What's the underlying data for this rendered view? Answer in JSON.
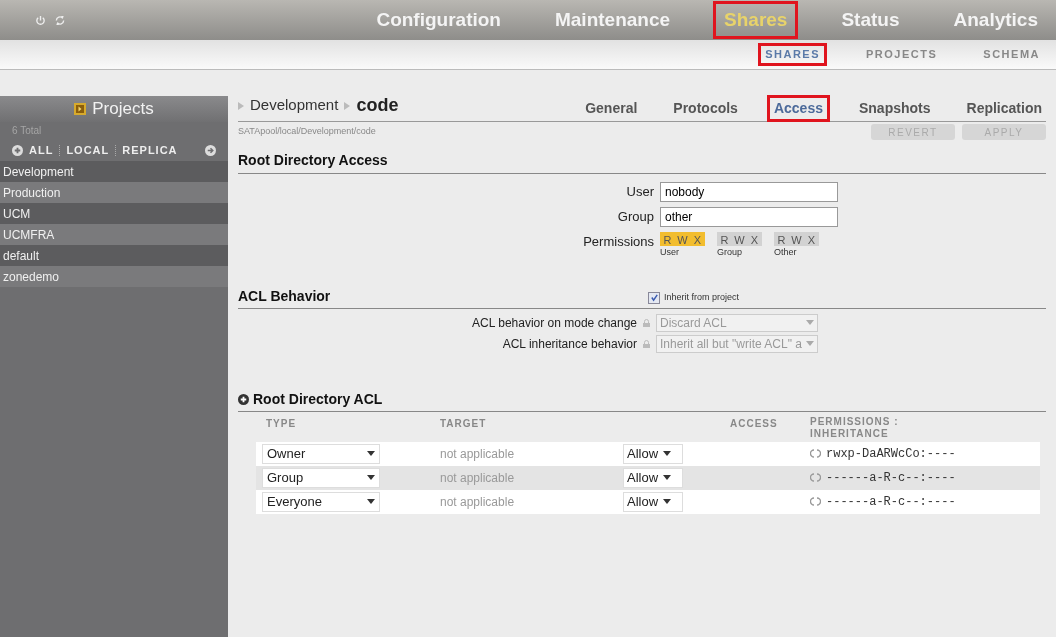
{
  "header": {
    "nav": [
      {
        "label": "Configuration",
        "selected": false,
        "highlighted": false
      },
      {
        "label": "Maintenance",
        "selected": false,
        "highlighted": false
      },
      {
        "label": "Shares",
        "selected": true,
        "highlighted": true
      },
      {
        "label": "Status",
        "selected": false,
        "highlighted": false
      },
      {
        "label": "Analytics",
        "selected": false,
        "highlighted": false
      }
    ],
    "subnav": [
      {
        "label": "SHARES",
        "selected": true,
        "highlighted": true
      },
      {
        "label": "PROJECTS",
        "selected": false,
        "highlighted": false
      },
      {
        "label": "SCHEMA",
        "selected": false,
        "highlighted": false
      }
    ]
  },
  "sidebar": {
    "title": "Projects",
    "count": "6 Total",
    "filters": [
      "ALL",
      "LOCAL",
      "REPLICA"
    ],
    "items": [
      "Development",
      "Production",
      "UCM",
      "UCMFRA",
      "default",
      "zonedemo"
    ]
  },
  "breadcrumb": [
    "Development",
    "code"
  ],
  "path": "SATApool/local/Development/code",
  "tabs": [
    {
      "label": "General",
      "selected": false,
      "highlighted": false
    },
    {
      "label": "Protocols",
      "selected": false,
      "highlighted": false
    },
    {
      "label": "Access",
      "selected": true,
      "highlighted": true
    },
    {
      "label": "Snapshots",
      "selected": false,
      "highlighted": false
    },
    {
      "label": "Replication",
      "selected": false,
      "highlighted": false
    }
  ],
  "buttons": [
    {
      "label": "REVERT",
      "disabled": true
    },
    {
      "label": "APPLY",
      "disabled": true
    }
  ],
  "root_access": {
    "title": "Root Directory Access",
    "user_label": "User",
    "user": "nobody",
    "group_label": "Group",
    "group": "other",
    "permissions_label": "Permissions",
    "permissions": [
      {
        "name": "User",
        "bits": [
          {
            "letter": "R",
            "on": true
          },
          {
            "letter": "W",
            "on": true
          },
          {
            "letter": "X",
            "on": true
          }
        ]
      },
      {
        "name": "Group",
        "bits": [
          {
            "letter": "R",
            "on": false
          },
          {
            "letter": "W",
            "on": false
          },
          {
            "letter": "X",
            "on": false
          }
        ]
      },
      {
        "name": "Other",
        "bits": [
          {
            "letter": "R",
            "on": false
          },
          {
            "letter": "W",
            "on": false
          },
          {
            "letter": "X",
            "on": false
          }
        ]
      }
    ]
  },
  "acl_behavior": {
    "title": "ACL Behavior",
    "inherit_label": "Inherit from project",
    "inherit": true,
    "fields": [
      {
        "label": "ACL behavior on mode change",
        "value": "Discard ACL",
        "disabled": true
      },
      {
        "label": "ACL inheritance behavior",
        "value": "Inherit all but \"write ACL\" a",
        "disabled": true
      }
    ]
  },
  "acl": {
    "title": "Root Directory ACL",
    "columns": [
      "TYPE",
      "TARGET",
      "ACCESS",
      "PERMISSIONS : INHERITANCE"
    ],
    "rows": [
      {
        "type": "Owner",
        "target": "not applicable",
        "access": "Allow",
        "permissions": "rwxp-DaARWcCo:----"
      },
      {
        "type": "Group",
        "target": "not applicable",
        "access": "Allow",
        "permissions": "------a-R-c--:----"
      },
      {
        "type": "Everyone",
        "target": "not applicable",
        "access": "Allow",
        "permissions": "------a-R-c--:----"
      }
    ]
  }
}
